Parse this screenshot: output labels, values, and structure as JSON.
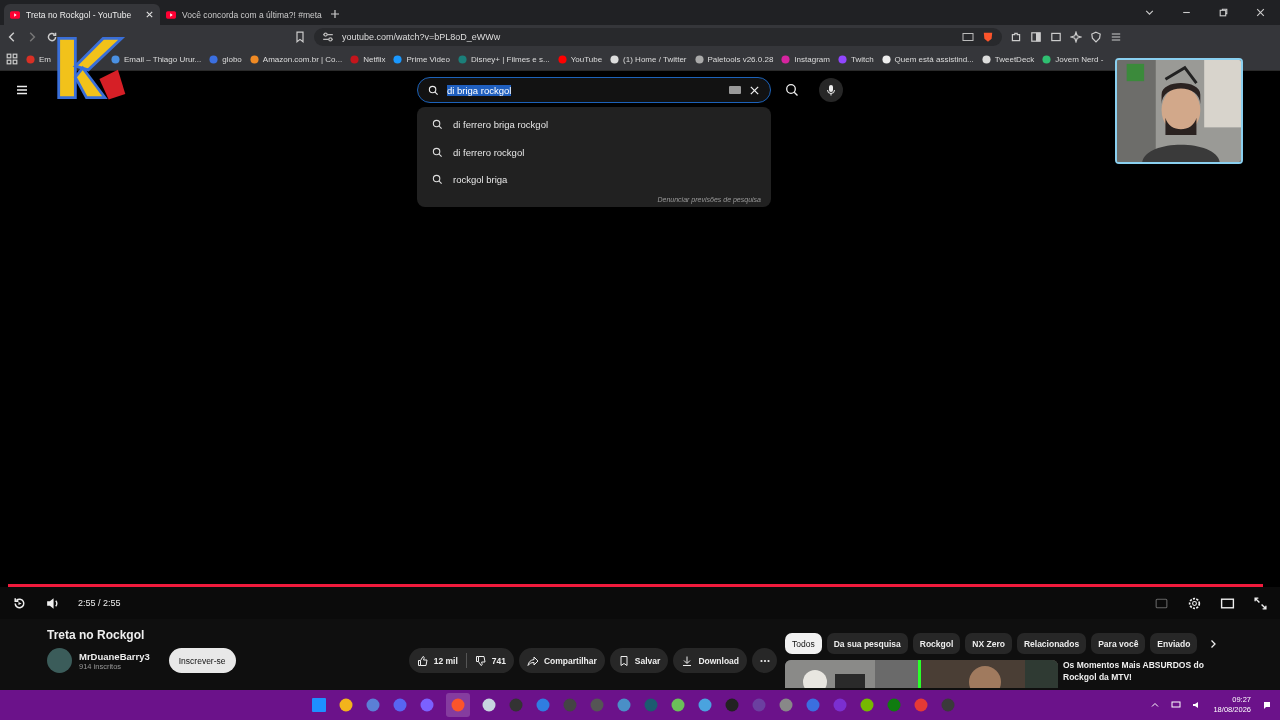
{
  "browser": {
    "tabs": [
      {
        "title": "Treta no Rockgol - YouTube",
        "selected": true
      },
      {
        "title": "Você concorda com a última?! #meta",
        "selected": false
      }
    ],
    "url": "youtube.com/watch?v=bPL8oD_eWWw",
    "bookmarks": [
      "Em",
      "Email – Thiago Urur...",
      "globo",
      "Amazon.com.br | Co...",
      "Netflix",
      "Prime Video",
      "Disney+ | Filmes e s...",
      "YouTube",
      "(1) Home / Twitter",
      "Paletools v26.0.28",
      "Instagram",
      "Twitch",
      "Quem está assistind...",
      "TweetDeck",
      "Jovem Nerd -"
    ]
  },
  "youtube": {
    "search": {
      "value": "di briga rockgol",
      "suggestions": [
        "di ferrero briga rockgol",
        "di ferrero rockgol",
        "rockgol briga"
      ],
      "report_link": "Denunciar previsões de pesquisa"
    },
    "player": {
      "level": 1,
      "time": "2:55 / 2:55"
    },
    "video": {
      "title": "Treta no Rockgol",
      "channel": "MrDuaneBarry3",
      "subscribers": "914 inscritos",
      "subscribe": "Inscrever-se",
      "likes": "12 mil",
      "dislikes": "741",
      "share": "Compartilhar",
      "save": "Salvar",
      "download": "Download"
    },
    "chips": [
      {
        "label": "Todos",
        "selected": true
      },
      {
        "label": "Da sua pesquisa",
        "selected": false
      },
      {
        "label": "Rockgol",
        "selected": false
      },
      {
        "label": "NX Zero",
        "selected": false
      },
      {
        "label": "Relacionados",
        "selected": false
      },
      {
        "label": "Para você",
        "selected": false
      },
      {
        "label": "Enviado",
        "selected": false
      }
    ],
    "recommended": {
      "title": "Os Momentos Mais ABSURDOS do Rockgol da MTV!"
    }
  },
  "taskbar": {
    "time": "09:27",
    "date": "18/08/2026"
  }
}
